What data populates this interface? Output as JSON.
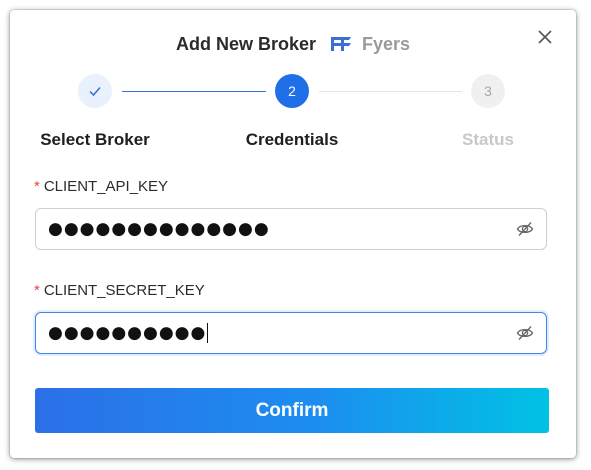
{
  "modal": {
    "title": "Add New Broker",
    "broker_name": "Fyers",
    "broker_logo_icon": "fyers-logo-icon",
    "close_icon": "close-icon"
  },
  "steps": [
    {
      "index": "1",
      "label": "Select Broker",
      "state": "completed",
      "icon": "check-icon"
    },
    {
      "index": "2",
      "label": "Credentials",
      "state": "active"
    },
    {
      "index": "3",
      "label": "Status",
      "state": "pending"
    }
  ],
  "form": {
    "fields": [
      {
        "label": "CLIENT_API_KEY",
        "required": true,
        "value": "●●●●●●●●●●●●●●",
        "type": "password",
        "focused": false,
        "toggle_icon": "eye-slash-icon"
      },
      {
        "label": "CLIENT_SECRET_KEY",
        "required": true,
        "value": "●●●●●●●●●●",
        "type": "password",
        "focused": true,
        "toggle_icon": "eye-slash-icon"
      }
    ],
    "required_marker": "*",
    "submit_label": "Confirm"
  },
  "colors": {
    "primary": "#1f6fe8",
    "gradient_end": "#00c2e4",
    "required": "#e54646"
  }
}
